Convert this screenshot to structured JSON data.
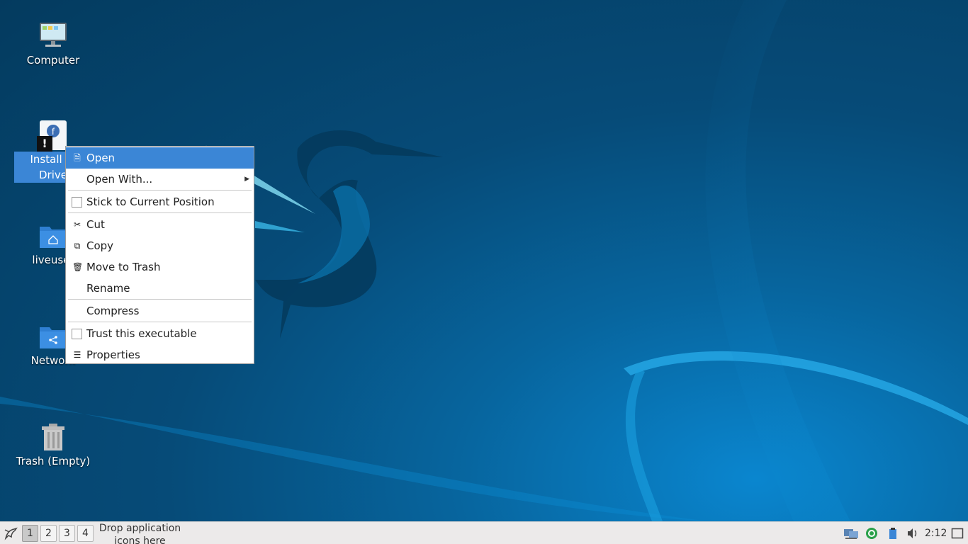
{
  "desktop": {
    "icons": [
      {
        "label": "Computer",
        "icon": "computer-icon"
      },
      {
        "label_line1": "Install to",
        "label_line2": "Drive",
        "icon": "fedora-installer-icon",
        "badge": "!"
      },
      {
        "label": "liveuser",
        "icon": "home-folder-icon"
      },
      {
        "label": "Network",
        "icon": "network-folder-icon"
      },
      {
        "label": "Trash (Empty)",
        "icon": "trash-icon"
      }
    ]
  },
  "context_menu": {
    "items": [
      {
        "label": "Open",
        "icon": "open-file-icon",
        "active": true
      },
      {
        "label": "Open With...",
        "submenu": true
      },
      {
        "label": "Stick to Current Position",
        "checkbox": true,
        "checked": false
      },
      {
        "label": "Cut",
        "icon": "scissors-icon"
      },
      {
        "label": "Copy",
        "icon": "copy-icon"
      },
      {
        "label": "Move to Trash",
        "icon": "trash-icon"
      },
      {
        "label": "Rename"
      },
      {
        "label": "Compress"
      },
      {
        "label": "Trust this executable",
        "checkbox": true,
        "checked": false
      },
      {
        "label": "Properties",
        "icon": "properties-icon"
      }
    ]
  },
  "taskbar": {
    "workspaces": [
      "1",
      "2",
      "3",
      "4"
    ],
    "current_workspace": "1",
    "drop_line1": "Drop application",
    "drop_line2": "icons here",
    "clock": "2:12",
    "tray_icons": [
      "network-icon",
      "update-icon",
      "clipboard-icon",
      "volume-icon",
      "show-desktop-icon"
    ]
  },
  "colors": {
    "selection": "#3b86d6",
    "panel": "#eceaea",
    "wallpaper": "#064b78"
  }
}
